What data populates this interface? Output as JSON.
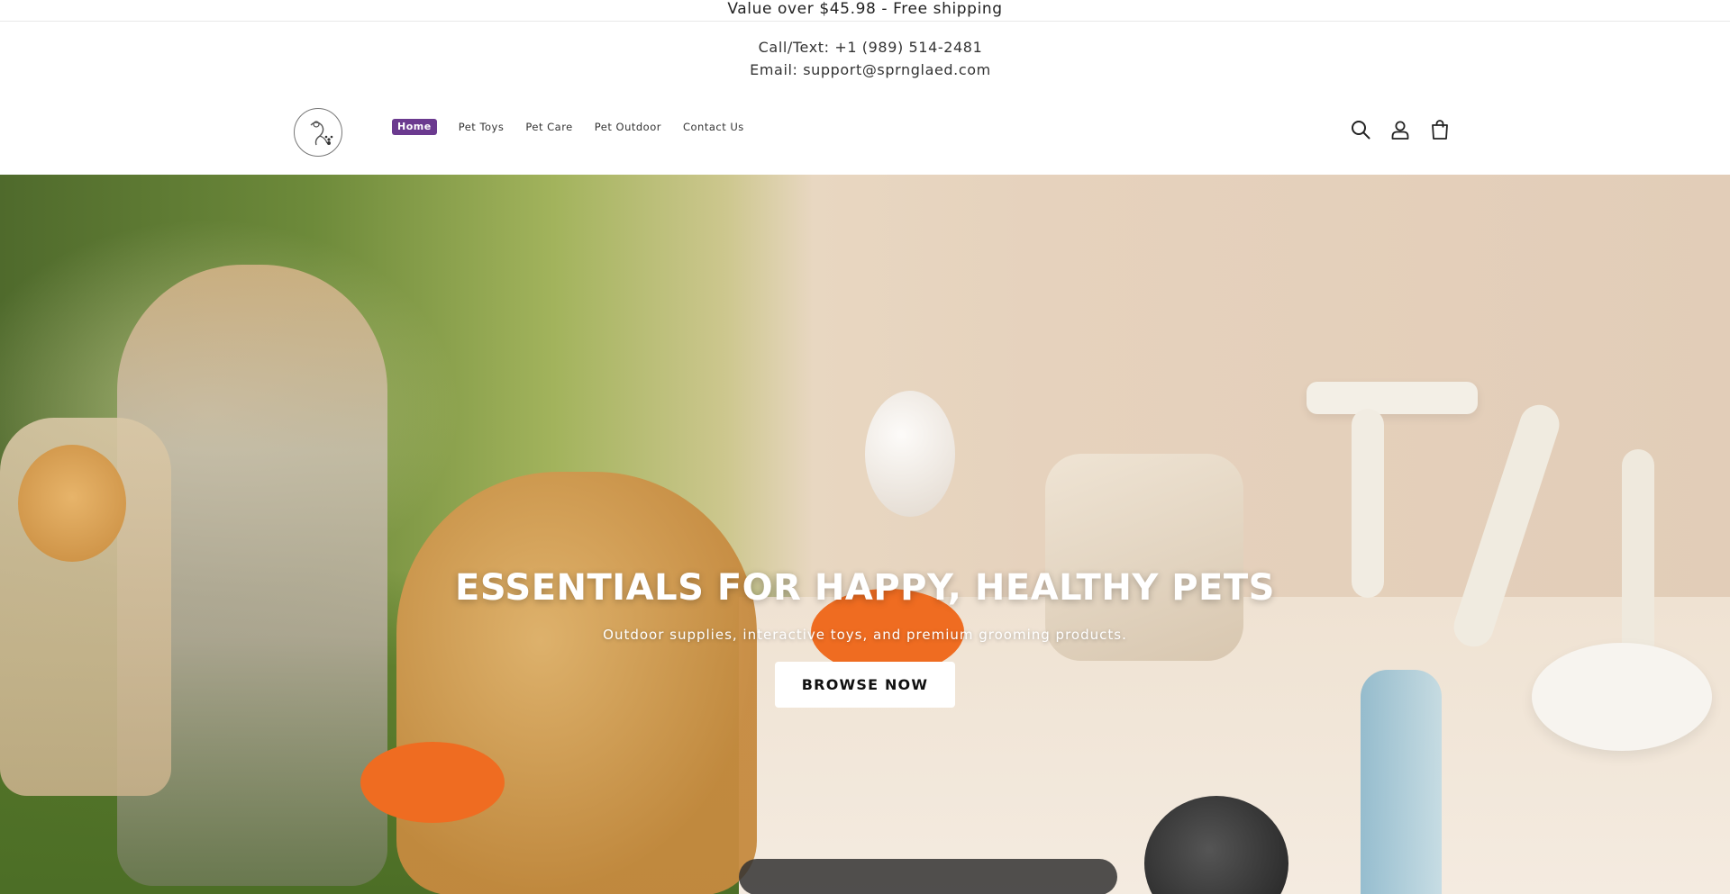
{
  "announcement": {
    "text": "Value over $45.98 - Free shipping"
  },
  "contact": {
    "phone": "Call/Text: +1 (989) 514-2481",
    "email": "Email: support@sprnglaed.com"
  },
  "nav": {
    "items": [
      {
        "label": "Home",
        "active": true
      },
      {
        "label": "Pet Toys"
      },
      {
        "label": "Pet Care"
      },
      {
        "label": "Pet Outdoor"
      },
      {
        "label": "Contact Us"
      }
    ]
  },
  "header_icons": [
    "search-icon",
    "account-icon",
    "cart-icon"
  ],
  "hero": {
    "title": "ESSENTIALS FOR HAPPY, HEALTHY PETS",
    "subtitle": "Outdoor supplies, interactive toys, and premium grooming products.",
    "cta_label": "BROWSE NOW"
  },
  "colors": {
    "accent": "#6b3a8f",
    "hero_left": "#5c7a30",
    "hero_right": "#e4d0bb"
  }
}
